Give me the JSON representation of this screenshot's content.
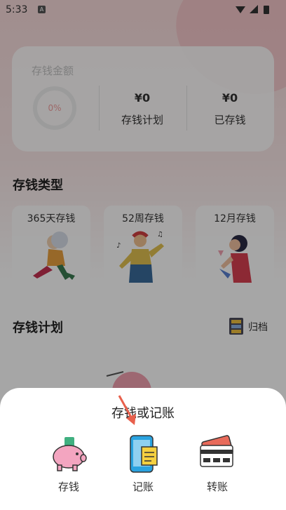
{
  "status_bar": {
    "time": "5:33",
    "notification_icon": "A"
  },
  "summary": {
    "label": "存钱金额",
    "progress": "0%",
    "plan_amount": "¥0",
    "plan_label": "存钱计划",
    "saved_amount": "¥0",
    "saved_label": "已存钱"
  },
  "types": {
    "title": "存钱类型",
    "items": [
      {
        "label": "365天存钱"
      },
      {
        "label": "52周存钱"
      },
      {
        "label": "12月存钱"
      }
    ]
  },
  "plans": {
    "title": "存钱计划",
    "archive_label": "归档"
  },
  "sheet": {
    "title": "存钱或记账",
    "actions": [
      {
        "label": "存钱",
        "icon": "piggy-bank-icon"
      },
      {
        "label": "记账",
        "icon": "phone-ledger-icon"
      },
      {
        "label": "转账",
        "icon": "card-transfer-icon"
      }
    ]
  },
  "colors": {
    "accent": "#e8604c",
    "pink": "#f2a0a0"
  }
}
